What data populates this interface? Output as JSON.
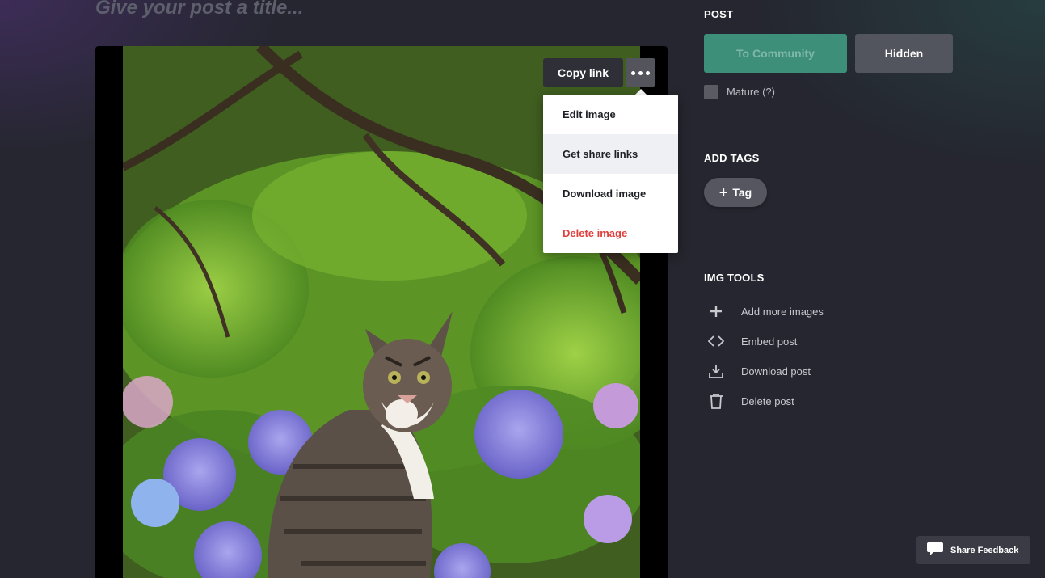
{
  "editor": {
    "title_placeholder": "Give your post a title..."
  },
  "image_toolbar": {
    "copy_link_label": "Copy link",
    "menu": {
      "items": [
        {
          "label": "Edit image"
        },
        {
          "label": "Get share links"
        },
        {
          "label": "Download image"
        },
        {
          "label": "Delete image",
          "color": "#e0403d"
        }
      ]
    }
  },
  "sidebar": {
    "post": {
      "heading": "POST",
      "community_label": "To Community",
      "hidden_label": "Hidden",
      "mature_label": "Mature (?)"
    },
    "tags": {
      "heading": "ADD TAGS",
      "tag_label": "Tag"
    },
    "img_tools": {
      "heading": "IMG TOOLS",
      "items": [
        {
          "icon": "plus-icon",
          "label": "Add more images"
        },
        {
          "icon": "code-icon",
          "label": "Embed post"
        },
        {
          "icon": "download-icon",
          "label": "Download post"
        },
        {
          "icon": "trash-icon",
          "label": "Delete post"
        }
      ]
    }
  },
  "feedback": {
    "label": "Share Feedback"
  },
  "colors": {
    "accent_green": "#3e8f79",
    "danger_red": "#e0403d",
    "background": "#25262f"
  }
}
